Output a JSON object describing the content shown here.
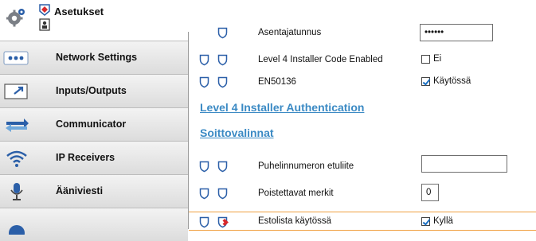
{
  "sidebar": {
    "title": "Asetukset",
    "items": [
      {
        "label": "Network Settings",
        "icon": "network-dots-icon"
      },
      {
        "label": "Inputs/Outputs",
        "icon": "io-arrow-icon"
      },
      {
        "label": "Communicator",
        "icon": "communicator-arrows-icon"
      },
      {
        "label": "IP Receivers",
        "icon": "wifi-icon"
      },
      {
        "label": "Ääniviesti",
        "icon": "microphone-icon"
      }
    ]
  },
  "settings": {
    "asentajatunnus": {
      "label": "Asentajatunnus",
      "value": "••••••"
    },
    "level4_code": {
      "label": "Level 4 Installer Code Enabled",
      "checked": false,
      "check_label": "Ei"
    },
    "en50136": {
      "label": "EN50136",
      "checked": true,
      "check_label": "Käytössä"
    },
    "section_level4": "Level 4 Installer Authentication",
    "section_soitto": "Soittovalinnat",
    "puhelin_etuliite": {
      "label": "Puhelinnumeron etuliite",
      "value": ""
    },
    "poistettavat": {
      "label": "Poistettavat merkit",
      "value": "0"
    },
    "estolista": {
      "label": "Estolista käytössä",
      "checked": true,
      "check_label": "Kyllä"
    }
  },
  "colors": {
    "link": "#3b8ac4",
    "shield_outline": "#2b5fa8",
    "shield_red": "#d8282c",
    "highlight_border": "#f0a040",
    "check_mark": "#1a6fc2"
  }
}
